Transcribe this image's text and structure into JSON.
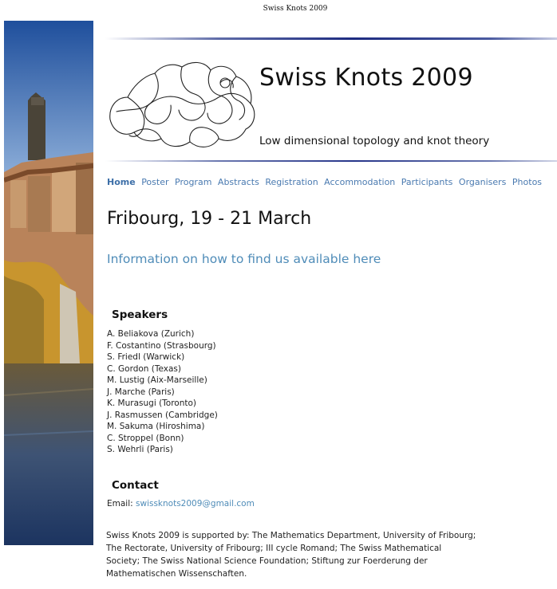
{
  "print_header": "Swiss Knots 2009",
  "site": {
    "title": "Swiss Knots 2009",
    "subtitle": "Low dimensional topology and knot theory"
  },
  "nav": [
    {
      "label": "Home",
      "active": true
    },
    {
      "label": "Poster"
    },
    {
      "label": "Program"
    },
    {
      "label": "Abstracts"
    },
    {
      "label": "Registration"
    },
    {
      "label": "Accommodation"
    },
    {
      "label": "Participants"
    },
    {
      "label": "Organisers"
    },
    {
      "label": "Photos"
    }
  ],
  "main": {
    "heading": "Fribourg, 19 - 21 March",
    "info_link": "Information on how to find us available here",
    "speakers_title": "Speakers",
    "speakers": [
      "A. Beliakova (Zurich)",
      "F. Costantino (Strasbourg)",
      "S. Friedl (Warwick)",
      "C. Gordon (Texas)",
      "M. Lustig (Aix-Marseille)",
      "J. Marche (Paris)",
      "K. Murasugi (Toronto)",
      "J. Rasmussen (Cambridge)",
      "M. Sakuma (Hiroshima)",
      "C. Stroppel (Bonn)",
      "S. Wehrli (Paris)"
    ],
    "contact_title": "Contact",
    "email_label": "Email: ",
    "email": "swissknots2009@gmail.com",
    "support_lines": [
      "Swiss Knots 2009 is supported by: The Mathematics Department, University of Fribourg;",
      "The Rectorate, University of Fribourg; III cycle Romand; The Swiss Mathematical",
      "Society; The Swiss National Science Foundation; Stiftung zur Foerderung der",
      "Mathematischen Wissenschaften."
    ]
  },
  "colors": {
    "link": "#4f8cb8",
    "nav_link": "#4a7ab0",
    "rule_dark": "#1d2b80"
  }
}
